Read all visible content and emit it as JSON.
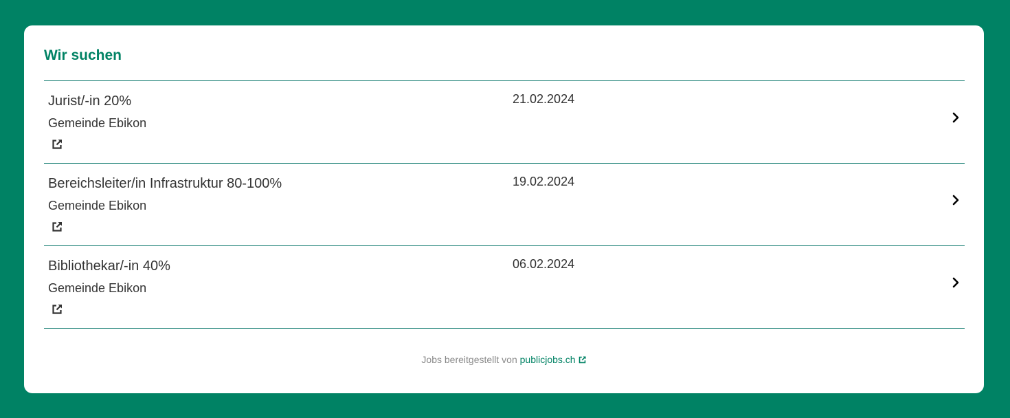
{
  "section": {
    "title": "Wir suchen"
  },
  "jobs": [
    {
      "title": "Jurist/-in 20%",
      "organization": "Gemeinde Ebikon",
      "date": "21.02.2024"
    },
    {
      "title": "Bereichsleiter/in Infrastruktur 80-100%",
      "organization": "Gemeinde Ebikon",
      "date": "19.02.2024"
    },
    {
      "title": "Bibliothekar/-in 40%",
      "organization": "Gemeinde Ebikon",
      "date": "06.02.2024"
    }
  ],
  "footer": {
    "prefix": "Jobs bereitgestellt von",
    "link_label": "publicjobs.ch"
  },
  "icons": {
    "external_link": "external-link-icon",
    "chevron": "chevron-right-icon"
  },
  "colors": {
    "brand_green": "#008264",
    "divider": "#0e7a6e",
    "text": "#333333",
    "muted": "#8a8a8a"
  }
}
